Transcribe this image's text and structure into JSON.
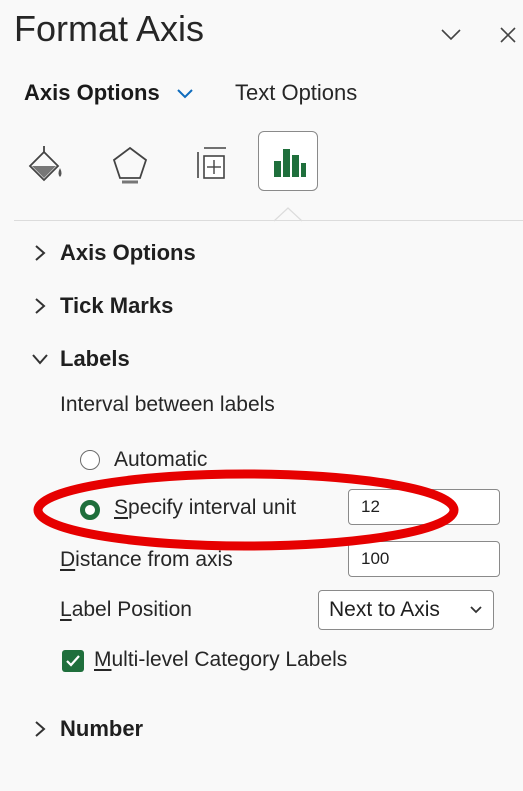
{
  "panel": {
    "title": "Format Axis",
    "header_icons": [
      "chevron-down-icon",
      "close-icon"
    ]
  },
  "subtabs": {
    "axis_options": "Axis Options",
    "text_options": "Text Options"
  },
  "icon_tabs": [
    "fill-line-icon",
    "effects-icon",
    "size-properties-icon",
    "axis-options-icon"
  ],
  "sections": {
    "axis_options": "Axis Options",
    "tick_marks": "Tick Marks",
    "labels": "Labels",
    "number": "Number"
  },
  "labels_section": {
    "interval_heading": "Interval between labels",
    "automatic": "Automatic",
    "specify_prefix": "S",
    "specify_rest": "pecify interval unit",
    "interval_value": "12",
    "distance_prefix": "D",
    "distance_rest": "istance from axis",
    "distance_value": "100",
    "label_position_prefix": "L",
    "label_position_rest": "abel Position",
    "label_position_value": "Next to Axis",
    "multilevel_prefix": "M",
    "multilevel_rest": "ulti-level Category Labels",
    "multilevel_checked": true
  },
  "colors": {
    "accent_green": "#1f6f3c",
    "annotation_red": "#e60000",
    "chevron_blue": "#0f6cbd"
  }
}
